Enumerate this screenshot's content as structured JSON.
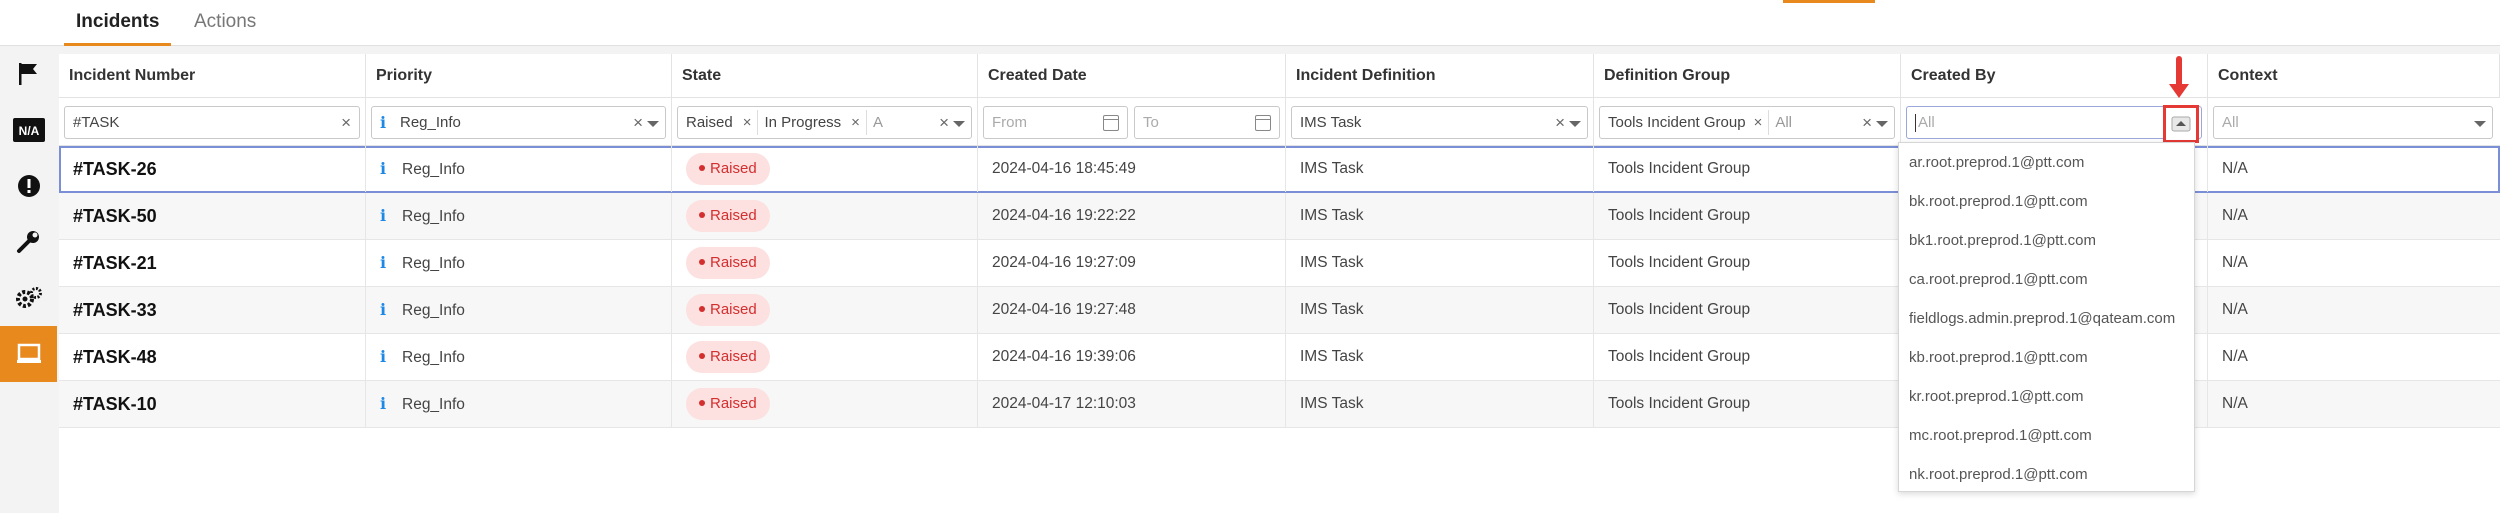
{
  "tabs": [
    {
      "label": "Incidents",
      "active": true
    },
    {
      "label": "Actions",
      "active": false
    }
  ],
  "rail_icons": [
    "flag-icon",
    "na-icon",
    "alert-icon",
    "wrench-icon",
    "gears-icon",
    "monitor-icon"
  ],
  "accent_color": "#e8891d",
  "columns": [
    "Incident Number",
    "Priority",
    "State",
    "Created Date",
    "Incident Definition",
    "Definition Group",
    "Created By",
    "Context"
  ],
  "filters": {
    "incident_number": "#TASK",
    "priority": "Reg_Info",
    "state_chips": [
      "Raised",
      "In Progress",
      "A"
    ],
    "date_from_placeholder": "From",
    "date_to_placeholder": "To",
    "incident_definition": "IMS Task",
    "definition_group": "Tools Incident Group",
    "definition_group_all": "All",
    "created_by_placeholder": "All",
    "context_placeholder": "All"
  },
  "rows": [
    {
      "number": "#TASK-26",
      "priority": "Reg_Info",
      "state": "Raised",
      "created": "2024-04-16 18:45:49",
      "definition": "IMS Task",
      "group": "Tools Incident Group",
      "context": "N/A"
    },
    {
      "number": "#TASK-50",
      "priority": "Reg_Info",
      "state": "Raised",
      "created": "2024-04-16 19:22:22",
      "definition": "IMS Task",
      "group": "Tools Incident Group",
      "context": "N/A"
    },
    {
      "number": "#TASK-21",
      "priority": "Reg_Info",
      "state": "Raised",
      "created": "2024-04-16 19:27:09",
      "definition": "IMS Task",
      "group": "Tools Incident Group",
      "context": "N/A"
    },
    {
      "number": "#TASK-33",
      "priority": "Reg_Info",
      "state": "Raised",
      "created": "2024-04-16 19:27:48",
      "definition": "IMS Task",
      "group": "Tools Incident Group",
      "context": "N/A"
    },
    {
      "number": "#TASK-48",
      "priority": "Reg_Info",
      "state": "Raised",
      "created": "2024-04-16 19:39:06",
      "definition": "IMS Task",
      "group": "Tools Incident Group",
      "context": "N/A"
    },
    {
      "number": "#TASK-10",
      "priority": "Reg_Info",
      "state": "Raised",
      "created": "2024-04-17 12:10:03",
      "definition": "IMS Task",
      "group": "Tools Incident Group",
      "context": "N/A"
    }
  ],
  "created_by_options": [
    "ar.root.preprod.1@ptt.com",
    "bk.root.preprod.1@ptt.com",
    "bk1.root.preprod.1@ptt.com",
    "ca.root.preprod.1@ptt.com",
    "fieldlogs.admin.preprod.1@qateam.com",
    "kb.root.preprod.1@ptt.com",
    "kr.root.preprod.1@ptt.com",
    "mc.root.preprod.1@ptt.com",
    "nk.root.preprod.1@ptt.com"
  ]
}
